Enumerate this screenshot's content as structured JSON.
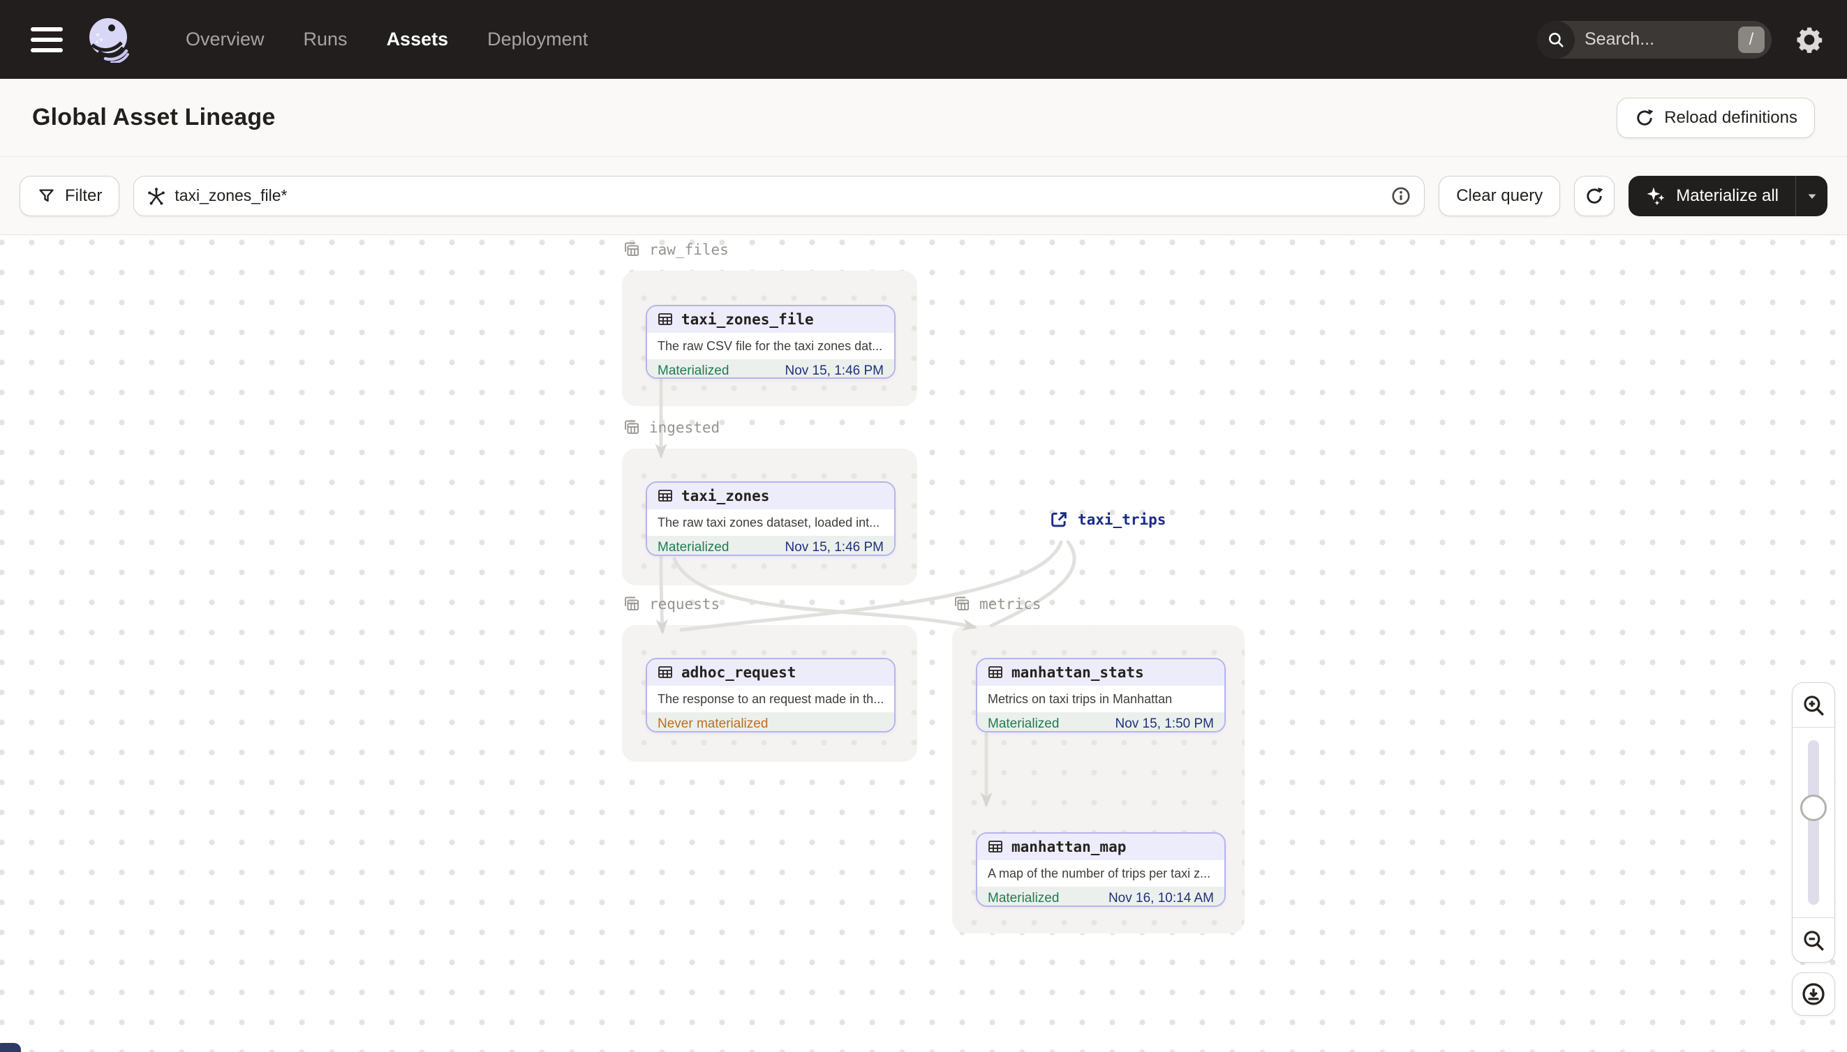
{
  "nav": {
    "menu_items": [
      {
        "label": "Overview",
        "active": false
      },
      {
        "label": "Runs",
        "active": false
      },
      {
        "label": "Assets",
        "active": true
      },
      {
        "label": "Deployment",
        "active": false
      }
    ],
    "search_placeholder": "Search...",
    "search_shortcut": "/"
  },
  "header": {
    "title": "Global Asset Lineage",
    "reload_button_label": "Reload definitions"
  },
  "toolbar": {
    "filter_label": "Filter",
    "query_value": "taxi_zones_file*",
    "clear_query_label": "Clear query",
    "materialize_label": "Materialize all"
  },
  "graph": {
    "groups": [
      {
        "name": "raw_files"
      },
      {
        "name": "ingested"
      },
      {
        "name": "requests"
      },
      {
        "name": "metrics"
      }
    ],
    "nodes": [
      {
        "name": "taxi_zones_file",
        "group": "raw_files",
        "description": "The raw CSV file for the taxi zones dat...",
        "status": "Materialized",
        "timestamp": "Nov 15, 1:46 PM"
      },
      {
        "name": "taxi_zones",
        "group": "ingested",
        "description": "The raw taxi zones dataset, loaded int...",
        "status": "Materialized",
        "timestamp": "Nov 15, 1:46 PM"
      },
      {
        "name": "adhoc_request",
        "group": "requests",
        "description": "The response to an request made in th...",
        "status": "Never materialized",
        "timestamp": ""
      },
      {
        "name": "manhattan_stats",
        "group": "metrics",
        "description": "Metrics on taxi trips in Manhattan",
        "status": "Materialized",
        "timestamp": "Nov 15, 1:50 PM"
      },
      {
        "name": "manhattan_map",
        "group": "metrics",
        "description": "A map of the number of trips per taxi z...",
        "status": "Materialized",
        "timestamp": "Nov 16, 10:14 AM"
      }
    ],
    "external_asset": {
      "name": "taxi_trips"
    },
    "edges": [
      {
        "from": "taxi_zones_file",
        "to": "taxi_zones"
      },
      {
        "from": "taxi_zones",
        "to": "adhoc_request"
      },
      {
        "from": "taxi_zones",
        "to": "manhattan_stats"
      },
      {
        "from": "taxi_trips",
        "to": "adhoc_request"
      },
      {
        "from": "taxi_trips",
        "to": "manhattan_stats"
      },
      {
        "from": "manhattan_stats",
        "to": "manhattan_map"
      }
    ]
  },
  "colors": {
    "nav_bg": "#221E1E",
    "node_border_purple": "#B6B3EE",
    "status_green": "#1F7B52",
    "status_orange": "#BD6E1E",
    "timestamp_navy": "#20307E",
    "edge_gray": "#E2E0DD"
  }
}
